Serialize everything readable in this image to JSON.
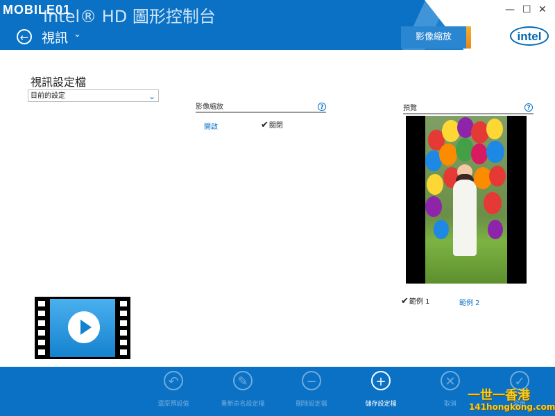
{
  "header": {
    "brand": "MOBILE01",
    "app_title": "Intel® HD 圖形控制台",
    "back_icon": "arrow-left-icon",
    "section_title": "視訊",
    "section_caret": "⌄",
    "feature_tab": "影像縮放",
    "window_controls": {
      "minimize": "—",
      "maximize": "☐",
      "close": "✕"
    },
    "intel_logo": "intel",
    "colors": {
      "blue": "#0a71c5",
      "accent": "#f0b02c"
    }
  },
  "profile": {
    "label": "視訊設定檔",
    "selected": "目前的設定"
  },
  "scaling": {
    "label": "影像縮放",
    "help": "?",
    "on_label": "開啟",
    "off_label": "關閉",
    "selected": "off"
  },
  "preview": {
    "label": "預覽",
    "help": "?",
    "sample1": "範例 1",
    "sample2": "範例 2",
    "selected_sample": 1
  },
  "actions": [
    {
      "label": "還原預設值",
      "icon": "undo-icon",
      "enabled": false
    },
    {
      "label": "重新命名設定檔",
      "icon": "pencil-icon",
      "enabled": false
    },
    {
      "label": "刪除設定檔",
      "icon": "minus-icon",
      "enabled": false
    },
    {
      "label": "儲存設定檔",
      "icon": "plus-icon",
      "enabled": true
    },
    {
      "label": "取消",
      "icon": "close-icon",
      "enabled": false
    },
    {
      "label": "套用",
      "icon": "check-icon",
      "enabled": false
    }
  ],
  "watermark": {
    "main": "一世一香港",
    "sub": "141hongkong.com"
  }
}
